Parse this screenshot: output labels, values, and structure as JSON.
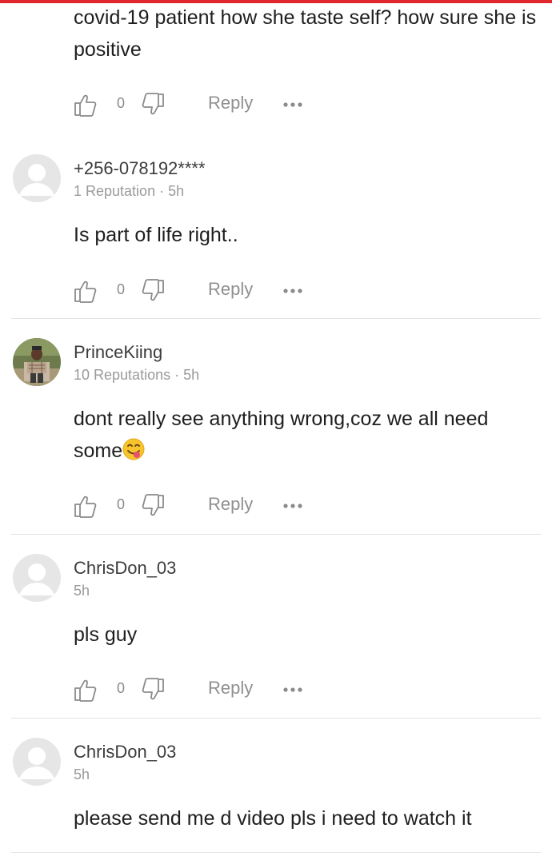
{
  "colors": {
    "accent": "#e0282e",
    "muted": "#8f8f8f"
  },
  "comments": [
    {
      "text": "covid-19 patient how she taste self? how sure she is positive",
      "likes": "0",
      "reply_label": "Reply"
    },
    {
      "username": "+256-078192****",
      "meta": "1 Reputation · 5h",
      "avatar": "default-avatar-icon",
      "text": "Is part of life right..",
      "likes": "0",
      "reply_label": "Reply"
    },
    {
      "username": "PrinceKiing",
      "meta": "10 Reputations · 5h",
      "avatar": "user-photo",
      "text": "dont really see anything  wrong,coz we all need some",
      "emoji": "savoring-food-face-emoji",
      "likes": "0",
      "reply_label": "Reply"
    },
    {
      "username": "ChrisDon_03",
      "meta": "5h",
      "avatar": "default-avatar-icon",
      "text": "pls guy",
      "likes": "0",
      "reply_label": "Reply"
    },
    {
      "username": "ChrisDon_03",
      "meta": "5h",
      "avatar": "default-avatar-icon",
      "text": "please send me d video pls i need to watch it"
    }
  ]
}
